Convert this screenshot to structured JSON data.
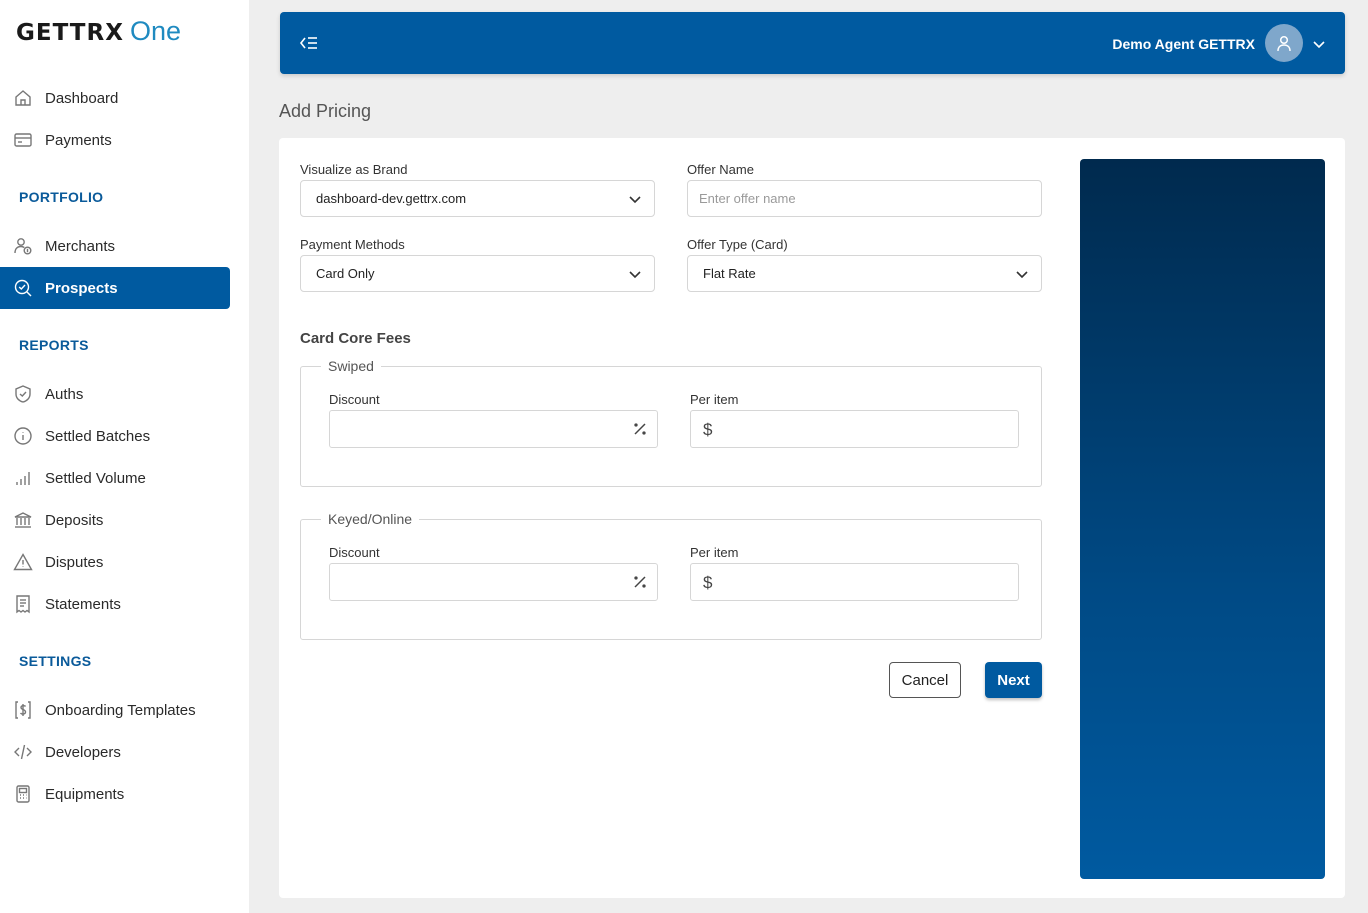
{
  "brand": {
    "name": "GETTRX",
    "suffix": "One"
  },
  "sidebar": {
    "top_items": [
      {
        "label": "Dashboard",
        "icon": "home-icon"
      },
      {
        "label": "Payments",
        "icon": "card-icon"
      }
    ],
    "sections": [
      {
        "title": "PORTFOLIO",
        "items": [
          {
            "label": "Merchants",
            "icon": "merchants-icon"
          },
          {
            "label": "Prospects",
            "icon": "prospects-search-icon",
            "active": true
          }
        ]
      },
      {
        "title": "REPORTS",
        "items": [
          {
            "label": "Auths",
            "icon": "shield-check-icon"
          },
          {
            "label": "Settled Batches",
            "icon": "info-circle-icon"
          },
          {
            "label": "Settled Volume",
            "icon": "bar-signal-icon"
          },
          {
            "label": "Deposits",
            "icon": "bank-icon"
          },
          {
            "label": "Disputes",
            "icon": "warning-icon"
          },
          {
            "label": "Statements",
            "icon": "receipt-icon"
          }
        ]
      },
      {
        "title": "SETTINGS",
        "items": [
          {
            "label": "Onboarding Templates",
            "icon": "dollar-document-icon"
          },
          {
            "label": "Developers",
            "icon": "code-icon"
          },
          {
            "label": "Equipments",
            "icon": "terminal-icon"
          }
        ]
      }
    ]
  },
  "header": {
    "user_name": "Demo Agent GETTRX"
  },
  "page": {
    "title": "Add Pricing"
  },
  "form": {
    "brand": {
      "label": "Visualize as Brand",
      "value": "dashboard-dev.gettrx.com"
    },
    "offer_name": {
      "label": "Offer Name",
      "placeholder": "Enter offer name",
      "value": ""
    },
    "payment_methods": {
      "label": "Payment Methods",
      "value": "Card Only"
    },
    "offer_type": {
      "label": "Offer Type (Card)",
      "value": "Flat Rate"
    },
    "group_title": "Card Core Fees",
    "swiped": {
      "legend": "Swiped",
      "discount_label": "Discount",
      "per_item_label": "Per item",
      "currency_symbol": "$"
    },
    "keyed": {
      "legend": "Keyed/Online",
      "discount_label": "Discount",
      "per_item_label": "Per item",
      "currency_symbol": "$"
    },
    "cancel_label": "Cancel",
    "next_label": "Next"
  },
  "colors": {
    "primary": "#005aa0",
    "section_title": "#0a5a9a",
    "logo_accent": "#1f8ac0"
  }
}
